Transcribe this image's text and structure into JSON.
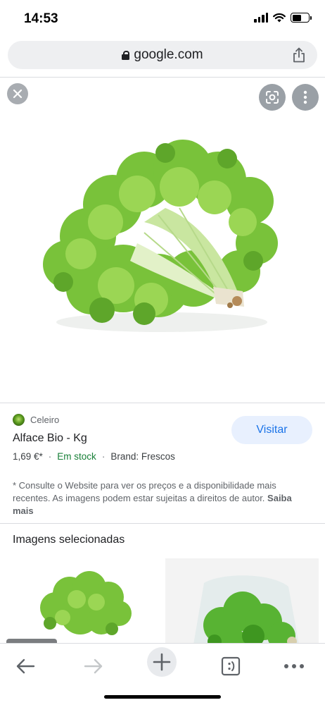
{
  "status": {
    "time": "14:53"
  },
  "browser": {
    "url": "google.com"
  },
  "product": {
    "source": "Celeiro",
    "title": "Alface Bio - Kg",
    "price": "1,69 €*",
    "availability": "Em stock",
    "brand": "Brand: Frescos",
    "visit_label": "Visitar"
  },
  "disclaimer": {
    "text": "* Consulte o Website para ver os preços e a disponibilidade mais recentes. As imagens podem estar sujeitas a direitos de autor. ",
    "link": "Saiba mais"
  },
  "related": {
    "title": "Imagens selecionadas"
  },
  "colors": {
    "accent": "#1a73e8",
    "stock": "#188038",
    "chip_bg": "#e8f0fe"
  },
  "icons": {
    "close": "close-icon",
    "lens": "lens-icon",
    "more": "more-vert-icon",
    "share": "share-icon",
    "back": "back-arrow-icon",
    "forward": "forward-arrow-icon",
    "new_tab": "plus-icon",
    "tabs": "tab-switcher-icon",
    "menu": "more-horiz-icon"
  }
}
